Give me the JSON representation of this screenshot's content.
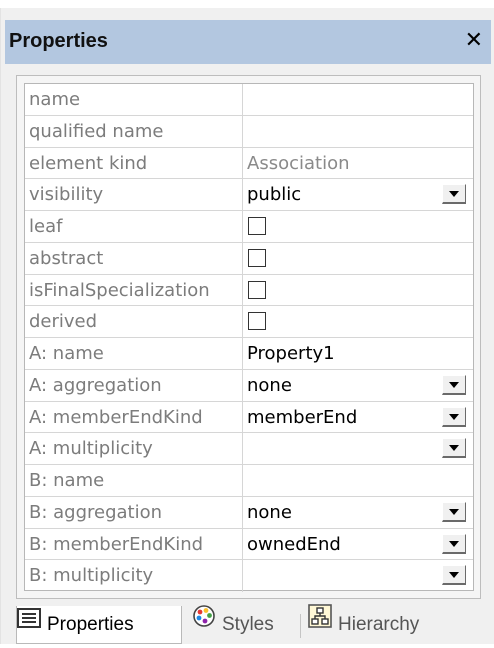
{
  "panel": {
    "title": "Properties",
    "close_glyph": "✕"
  },
  "properties": [
    {
      "key": "name",
      "value": "",
      "type": "text"
    },
    {
      "key": "qualified name",
      "value": "",
      "type": "text"
    },
    {
      "key": "element kind",
      "value": "Association",
      "type": "readonly"
    },
    {
      "key": "visibility",
      "value": "public",
      "type": "dropdown"
    },
    {
      "key": "leaf",
      "value": "",
      "type": "checkbox"
    },
    {
      "key": "abstract",
      "value": "",
      "type": "checkbox"
    },
    {
      "key": "isFinalSpecialization",
      "value": "",
      "type": "checkbox"
    },
    {
      "key": "derived",
      "value": "",
      "type": "checkbox"
    },
    {
      "key": "A: name",
      "value": "Property1",
      "type": "text"
    },
    {
      "key": "A: aggregation",
      "value": "none",
      "type": "dropdown"
    },
    {
      "key": "A: memberEndKind",
      "value": "memberEnd",
      "type": "dropdown"
    },
    {
      "key": "A: multiplicity",
      "value": "",
      "type": "dropdown"
    },
    {
      "key": "B: name",
      "value": "",
      "type": "text"
    },
    {
      "key": "B: aggregation",
      "value": "none",
      "type": "dropdown"
    },
    {
      "key": "B: memberEndKind",
      "value": "ownedEnd",
      "type": "dropdown"
    },
    {
      "key": "B: multiplicity",
      "value": "",
      "type": "dropdown"
    }
  ],
  "tabs": [
    {
      "label": "Properties",
      "icon": "properties-list-icon",
      "active": true
    },
    {
      "label": "Styles",
      "icon": "palette-icon",
      "active": false
    },
    {
      "label": "Hierarchy",
      "icon": "hierarchy-icon",
      "active": false
    }
  ],
  "colors": {
    "title_bar": "#b3c7e0",
    "key_text": "#7c7c7c",
    "grid_line": "#d6d6d6"
  }
}
